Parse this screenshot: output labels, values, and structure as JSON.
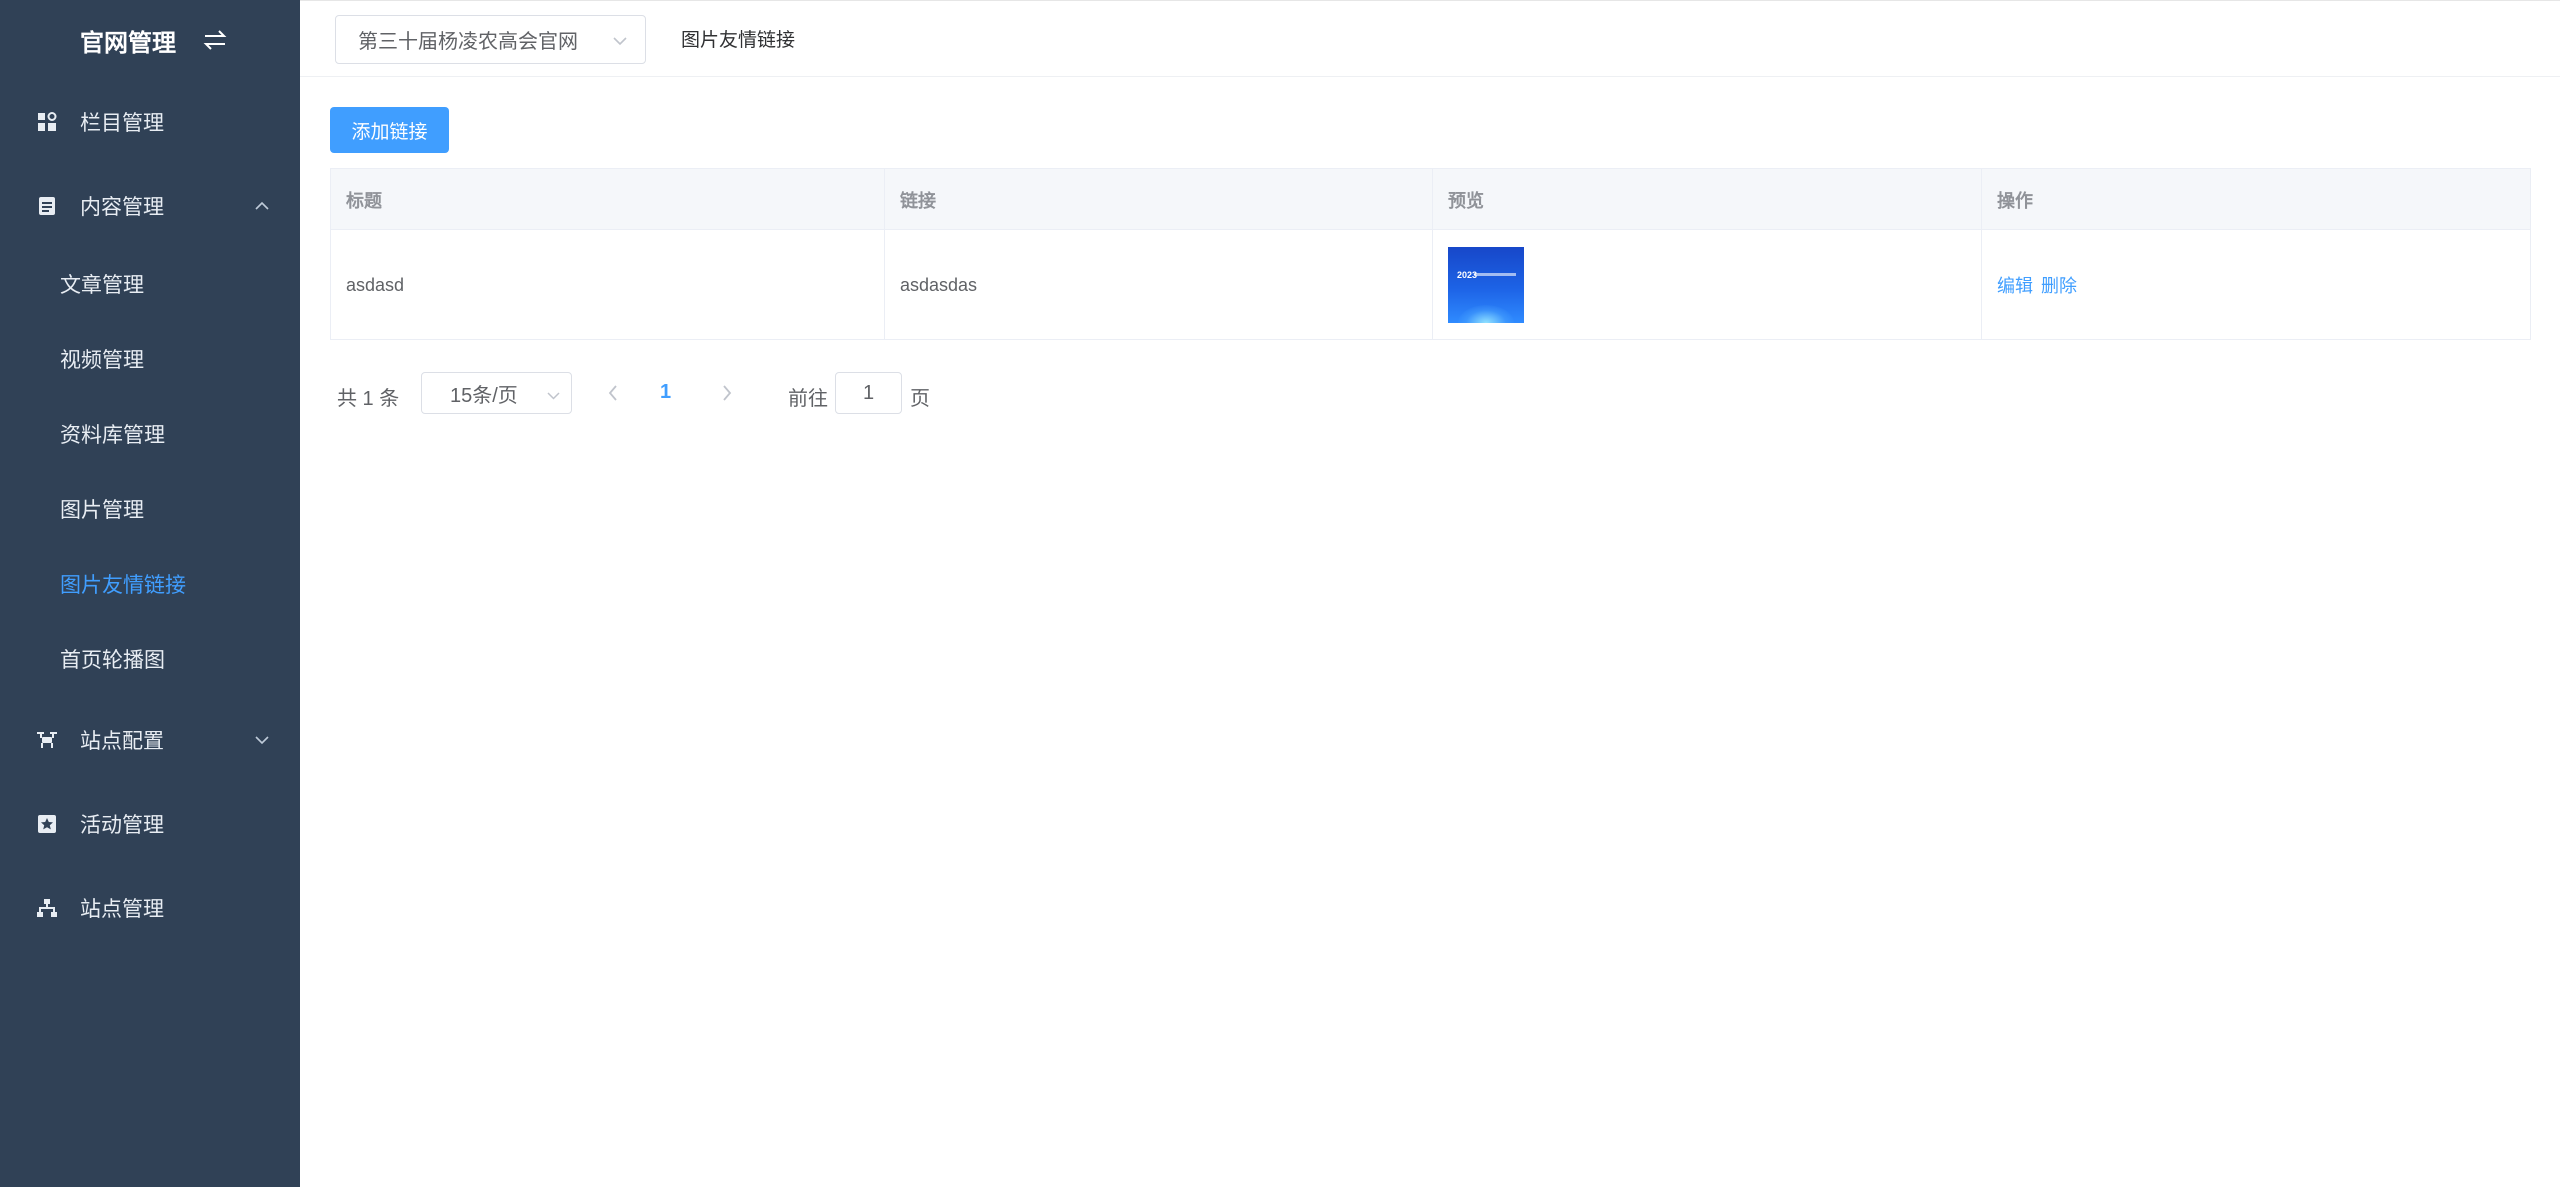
{
  "sidebar": {
    "brand": "官网管理",
    "menu": [
      {
        "label": "栏目管理"
      },
      {
        "label": "内容管理"
      },
      {
        "label": "站点配置"
      },
      {
        "label": "活动管理"
      },
      {
        "label": "站点管理"
      }
    ],
    "content_submenu": [
      {
        "label": "文章管理"
      },
      {
        "label": "视频管理"
      },
      {
        "label": "资料库管理"
      },
      {
        "label": "图片管理"
      },
      {
        "label": "图片友情链接"
      },
      {
        "label": "首页轮播图"
      }
    ],
    "active_item": "图片友情链接"
  },
  "header": {
    "site_select_value": "第三十届杨凌农高会官网",
    "breadcrumb": "图片友情链接"
  },
  "main": {
    "add_button": "添加链接",
    "table": {
      "columns": [
        "标题",
        "链接",
        "预览",
        "操作"
      ],
      "rows": [
        {
          "title": "asdasd",
          "link": "asdasdas",
          "preview_text": "2023",
          "actions": [
            "编辑",
            "删除"
          ]
        }
      ]
    },
    "pagination": {
      "total_text": "共 1 条",
      "page_size": "15条/页",
      "current_page": "1",
      "goto_label": "前往",
      "goto_value": "1",
      "goto_suffix": "页"
    }
  },
  "colors": {
    "sidebar_bg": "#304156",
    "accent": "#409eff"
  }
}
